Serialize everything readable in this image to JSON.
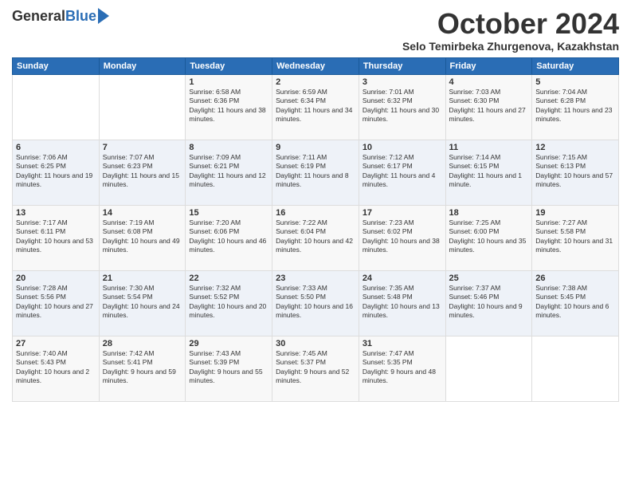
{
  "logo": {
    "general": "General",
    "blue": "Blue"
  },
  "title": "October 2024",
  "location": "Selo Temirbeka Zhurgenova, Kazakhstan",
  "days_of_week": [
    "Sunday",
    "Monday",
    "Tuesday",
    "Wednesday",
    "Thursday",
    "Friday",
    "Saturday"
  ],
  "weeks": [
    [
      {
        "day": "",
        "sunrise": "",
        "sunset": "",
        "daylight": ""
      },
      {
        "day": "",
        "sunrise": "",
        "sunset": "",
        "daylight": ""
      },
      {
        "day": "1",
        "sunrise": "Sunrise: 6:58 AM",
        "sunset": "Sunset: 6:36 PM",
        "daylight": "Daylight: 11 hours and 38 minutes."
      },
      {
        "day": "2",
        "sunrise": "Sunrise: 6:59 AM",
        "sunset": "Sunset: 6:34 PM",
        "daylight": "Daylight: 11 hours and 34 minutes."
      },
      {
        "day": "3",
        "sunrise": "Sunrise: 7:01 AM",
        "sunset": "Sunset: 6:32 PM",
        "daylight": "Daylight: 11 hours and 30 minutes."
      },
      {
        "day": "4",
        "sunrise": "Sunrise: 7:03 AM",
        "sunset": "Sunset: 6:30 PM",
        "daylight": "Daylight: 11 hours and 27 minutes."
      },
      {
        "day": "5",
        "sunrise": "Sunrise: 7:04 AM",
        "sunset": "Sunset: 6:28 PM",
        "daylight": "Daylight: 11 hours and 23 minutes."
      }
    ],
    [
      {
        "day": "6",
        "sunrise": "Sunrise: 7:06 AM",
        "sunset": "Sunset: 6:25 PM",
        "daylight": "Daylight: 11 hours and 19 minutes."
      },
      {
        "day": "7",
        "sunrise": "Sunrise: 7:07 AM",
        "sunset": "Sunset: 6:23 PM",
        "daylight": "Daylight: 11 hours and 15 minutes."
      },
      {
        "day": "8",
        "sunrise": "Sunrise: 7:09 AM",
        "sunset": "Sunset: 6:21 PM",
        "daylight": "Daylight: 11 hours and 12 minutes."
      },
      {
        "day": "9",
        "sunrise": "Sunrise: 7:11 AM",
        "sunset": "Sunset: 6:19 PM",
        "daylight": "Daylight: 11 hours and 8 minutes."
      },
      {
        "day": "10",
        "sunrise": "Sunrise: 7:12 AM",
        "sunset": "Sunset: 6:17 PM",
        "daylight": "Daylight: 11 hours and 4 minutes."
      },
      {
        "day": "11",
        "sunrise": "Sunrise: 7:14 AM",
        "sunset": "Sunset: 6:15 PM",
        "daylight": "Daylight: 11 hours and 1 minute."
      },
      {
        "day": "12",
        "sunrise": "Sunrise: 7:15 AM",
        "sunset": "Sunset: 6:13 PM",
        "daylight": "Daylight: 10 hours and 57 minutes."
      }
    ],
    [
      {
        "day": "13",
        "sunrise": "Sunrise: 7:17 AM",
        "sunset": "Sunset: 6:11 PM",
        "daylight": "Daylight: 10 hours and 53 minutes."
      },
      {
        "day": "14",
        "sunrise": "Sunrise: 7:19 AM",
        "sunset": "Sunset: 6:08 PM",
        "daylight": "Daylight: 10 hours and 49 minutes."
      },
      {
        "day": "15",
        "sunrise": "Sunrise: 7:20 AM",
        "sunset": "Sunset: 6:06 PM",
        "daylight": "Daylight: 10 hours and 46 minutes."
      },
      {
        "day": "16",
        "sunrise": "Sunrise: 7:22 AM",
        "sunset": "Sunset: 6:04 PM",
        "daylight": "Daylight: 10 hours and 42 minutes."
      },
      {
        "day": "17",
        "sunrise": "Sunrise: 7:23 AM",
        "sunset": "Sunset: 6:02 PM",
        "daylight": "Daylight: 10 hours and 38 minutes."
      },
      {
        "day": "18",
        "sunrise": "Sunrise: 7:25 AM",
        "sunset": "Sunset: 6:00 PM",
        "daylight": "Daylight: 10 hours and 35 minutes."
      },
      {
        "day": "19",
        "sunrise": "Sunrise: 7:27 AM",
        "sunset": "Sunset: 5:58 PM",
        "daylight": "Daylight: 10 hours and 31 minutes."
      }
    ],
    [
      {
        "day": "20",
        "sunrise": "Sunrise: 7:28 AM",
        "sunset": "Sunset: 5:56 PM",
        "daylight": "Daylight: 10 hours and 27 minutes."
      },
      {
        "day": "21",
        "sunrise": "Sunrise: 7:30 AM",
        "sunset": "Sunset: 5:54 PM",
        "daylight": "Daylight: 10 hours and 24 minutes."
      },
      {
        "day": "22",
        "sunrise": "Sunrise: 7:32 AM",
        "sunset": "Sunset: 5:52 PM",
        "daylight": "Daylight: 10 hours and 20 minutes."
      },
      {
        "day": "23",
        "sunrise": "Sunrise: 7:33 AM",
        "sunset": "Sunset: 5:50 PM",
        "daylight": "Daylight: 10 hours and 16 minutes."
      },
      {
        "day": "24",
        "sunrise": "Sunrise: 7:35 AM",
        "sunset": "Sunset: 5:48 PM",
        "daylight": "Daylight: 10 hours and 13 minutes."
      },
      {
        "day": "25",
        "sunrise": "Sunrise: 7:37 AM",
        "sunset": "Sunset: 5:46 PM",
        "daylight": "Daylight: 10 hours and 9 minutes."
      },
      {
        "day": "26",
        "sunrise": "Sunrise: 7:38 AM",
        "sunset": "Sunset: 5:45 PM",
        "daylight": "Daylight: 10 hours and 6 minutes."
      }
    ],
    [
      {
        "day": "27",
        "sunrise": "Sunrise: 7:40 AM",
        "sunset": "Sunset: 5:43 PM",
        "daylight": "Daylight: 10 hours and 2 minutes."
      },
      {
        "day": "28",
        "sunrise": "Sunrise: 7:42 AM",
        "sunset": "Sunset: 5:41 PM",
        "daylight": "Daylight: 9 hours and 59 minutes."
      },
      {
        "day": "29",
        "sunrise": "Sunrise: 7:43 AM",
        "sunset": "Sunset: 5:39 PM",
        "daylight": "Daylight: 9 hours and 55 minutes."
      },
      {
        "day": "30",
        "sunrise": "Sunrise: 7:45 AM",
        "sunset": "Sunset: 5:37 PM",
        "daylight": "Daylight: 9 hours and 52 minutes."
      },
      {
        "day": "31",
        "sunrise": "Sunrise: 7:47 AM",
        "sunset": "Sunset: 5:35 PM",
        "daylight": "Daylight: 9 hours and 48 minutes."
      },
      {
        "day": "",
        "sunrise": "",
        "sunset": "",
        "daylight": ""
      },
      {
        "day": "",
        "sunrise": "",
        "sunset": "",
        "daylight": ""
      }
    ]
  ]
}
